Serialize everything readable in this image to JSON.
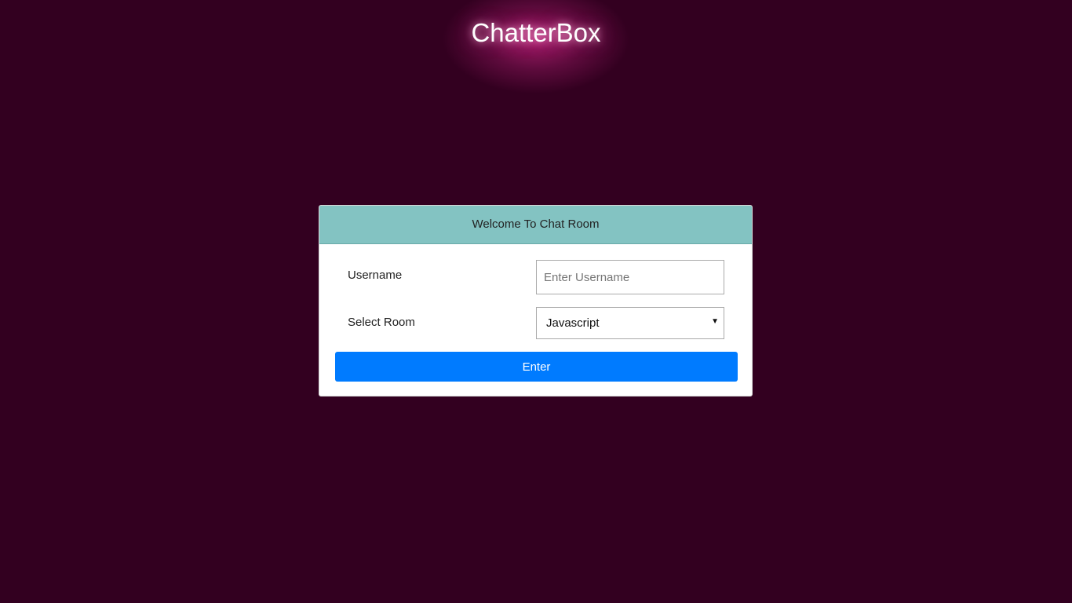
{
  "brand": {
    "title": "ChatterBox"
  },
  "card": {
    "header": "Welcome To Chat Room",
    "username": {
      "label": "Username",
      "placeholder": "Enter Username",
      "value": ""
    },
    "room": {
      "label": "Select Room",
      "selected": "Javascript"
    },
    "submit_label": "Enter"
  },
  "colors": {
    "background": "#330020",
    "header": "#83c3c2",
    "button": "#007bff",
    "glow": "#aa1e6e"
  },
  "icons": {
    "select_caret": "chevron-down-icon"
  }
}
